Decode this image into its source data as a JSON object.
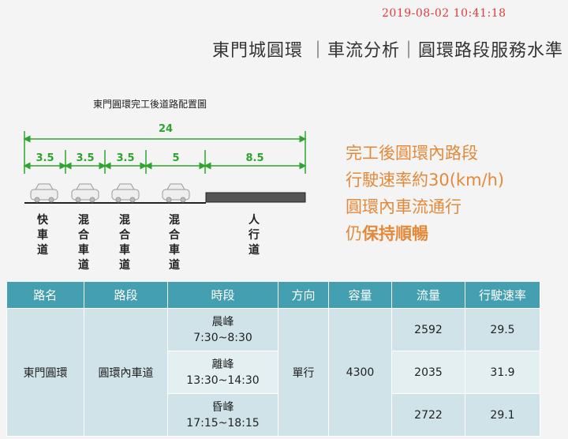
{
  "timestamp": "2019-08-02   10:41:18",
  "title": "東門城圓環 ｜車流分析｜圓環路段服務水準",
  "diagram": {
    "title": "東門圓環完工後道路配置圖",
    "total_width": "24",
    "segments": [
      "3.5",
      "3.5",
      "3.5",
      "5",
      "8.5"
    ],
    "lanes": [
      "快車道",
      "混合車道",
      "混合車道",
      "混合車道",
      "人行道"
    ]
  },
  "notes": {
    "line1": "完工後圓環內路段",
    "line2": "行駛速率約30(km/h)",
    "line3": "圓環內車流通行",
    "line4_a": "仍",
    "line4_b": "保持順暢"
  },
  "table": {
    "headers": [
      "路名",
      "路段",
      "時段",
      "方向",
      "容量",
      "流量",
      "行駛速率"
    ],
    "road": "東門圓環",
    "section": "圓環內車道",
    "direction": "單行",
    "capacity": "4300",
    "rows": [
      {
        "period": "晨峰",
        "time": "7:30~8:30",
        "flow": "2592",
        "speed": "29.5"
      },
      {
        "period": "離峰",
        "time": "13:30~14:30",
        "flow": "2035",
        "speed": "31.9"
      },
      {
        "period": "昏峰",
        "time": "17:15~18:15",
        "flow": "2722",
        "speed": "29.1"
      }
    ]
  }
}
